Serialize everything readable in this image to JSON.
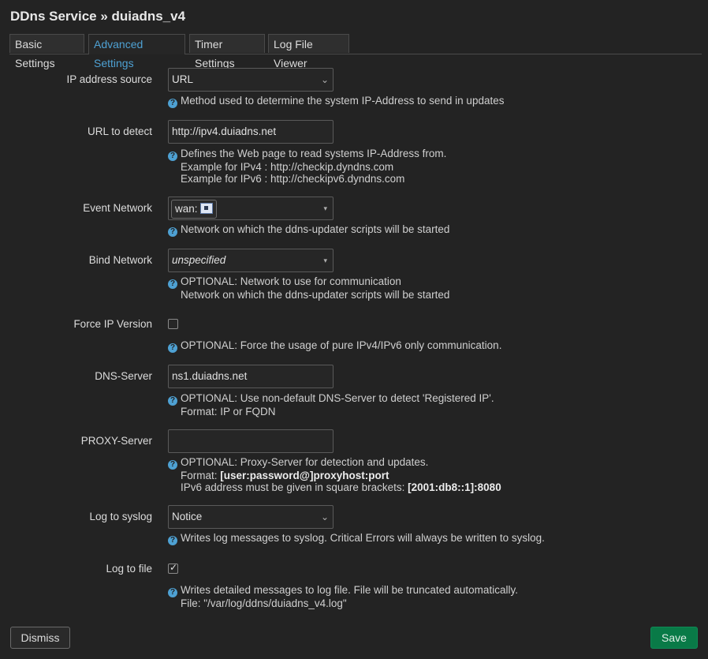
{
  "header": {
    "title": "DDns Service » duiadns_v4"
  },
  "tabs": [
    {
      "label": "Basic Settings",
      "active": false
    },
    {
      "label": "Advanced Settings",
      "active": true
    },
    {
      "label": "Timer Settings",
      "active": false
    },
    {
      "label": "Log File Viewer",
      "active": false
    }
  ],
  "fields": {
    "ip_source": {
      "label": "IP address source",
      "value": "URL",
      "help": "Method used to determine the system IP-Address to send in updates"
    },
    "url_detect": {
      "label": "URL to detect",
      "value": "http://ipv4.duiadns.net",
      "help1": "Defines the Web page to read systems IP-Address from.",
      "help2": "Example for IPv4 : http://checkip.dyndns.com",
      "help3": "Example for IPv6 : http://checkipv6.dyndns.com"
    },
    "event_network": {
      "label": "Event Network",
      "value": "wan:",
      "help": "Network on which the ddns-updater scripts will be started"
    },
    "bind_network": {
      "label": "Bind Network",
      "value": "unspecified",
      "help1": "OPTIONAL: Network to use for communication",
      "help2": "Network on which the ddns-updater scripts will be started"
    },
    "force_ip": {
      "label": "Force IP Version",
      "checked": false,
      "help": "OPTIONAL: Force the usage of pure IPv4/IPv6 only communication."
    },
    "dns_server": {
      "label": "DNS-Server",
      "value": "ns1.duiadns.net",
      "help1": "OPTIONAL: Use non-default DNS-Server to detect 'Registered IP'.",
      "help2": "Format: IP or FQDN"
    },
    "proxy_server": {
      "label": "PROXY-Server",
      "value": "",
      "help1": "OPTIONAL: Proxy-Server for detection and updates.",
      "help2_prefix": "Format: ",
      "help2_bold": "[user:password@]proxyhost:port",
      "help3_prefix": "IPv6 address must be given in square brackets: ",
      "help3_bold": "[2001:db8::1]:8080"
    },
    "log_syslog": {
      "label": "Log to syslog",
      "value": "Notice",
      "help": "Writes log messages to syslog. Critical Errors will always be written to syslog."
    },
    "log_file": {
      "label": "Log to file",
      "checked": true,
      "help1": "Writes detailed messages to log file. File will be truncated automatically.",
      "help2": "File: \"/var/log/ddns/duiadns_v4.log\""
    }
  },
  "icons": {
    "help": "?",
    "chevron": "⌄",
    "caret": "▾",
    "check": "✓"
  },
  "buttons": {
    "dismiss": "Dismiss",
    "save": "Save"
  },
  "colors": {
    "accent": "#4ea1d3",
    "save": "#097a47",
    "background": "#232323"
  }
}
